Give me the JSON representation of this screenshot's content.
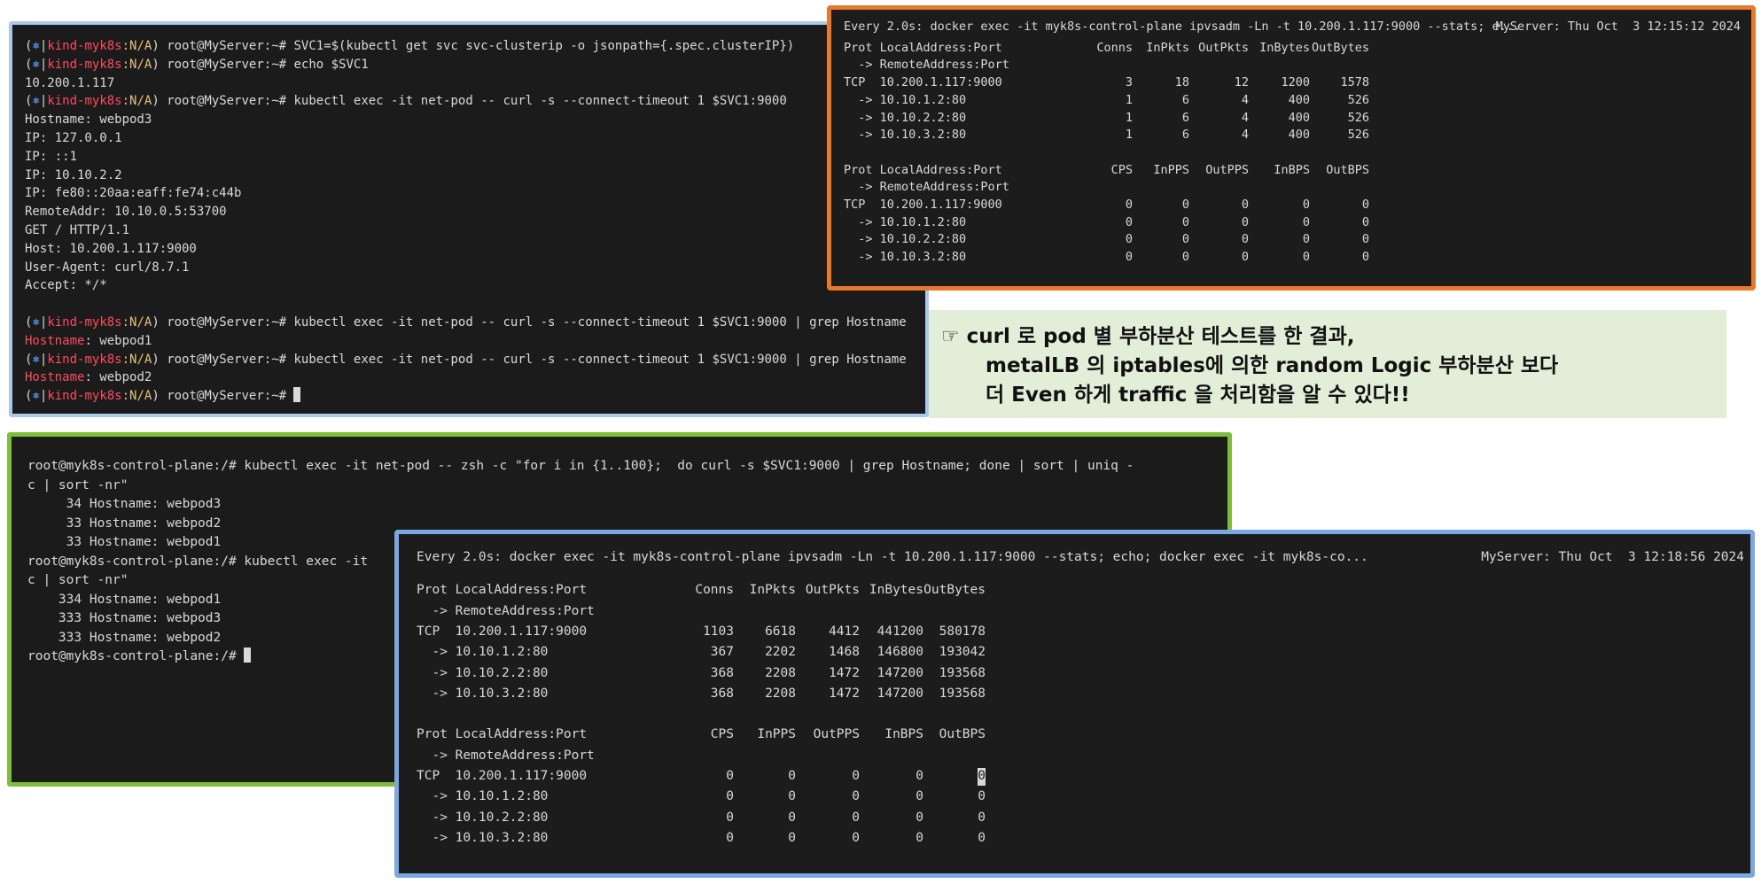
{
  "colors": {
    "panel1_border": "#a9c8ec",
    "panel2_border": "#e8782a",
    "panel3_border": "#7dbd3a",
    "panel4_border": "#79a9e0",
    "note_bg": "#e2eed8",
    "terminal_bg": "#1b1b1b",
    "prompt_blue": "#5aa0ff",
    "prompt_red": "#ff4b5c"
  },
  "terminal1": {
    "prompt": {
      "open": "(",
      "symbol": "⎈",
      "bar": "|",
      "context": "kind-myk8s",
      "ns": ":N/A",
      "close": ")",
      "user": " root@MyServer:~# "
    },
    "commands": [
      "SVC1=$(kubectl get svc svc-clusterip -o jsonpath={.spec.clusterIP})",
      "echo $SVC1",
      "kubectl exec -it net-pod -- curl -s --connect-timeout 1 $SVC1:9000",
      "kubectl exec -it net-pod -- curl -s --connect-timeout 1 $SVC1:9000 | grep Hostname",
      "kubectl exec -it net-pod -- curl -s --connect-timeout 1 $SVC1:9000 | grep Hostname"
    ],
    "echo_output": "10.200.1.117",
    "curl_output": [
      "Hostname: webpod3",
      "IP: 127.0.0.1",
      "IP: ::1",
      "IP: 10.10.2.2",
      "IP: fe80::20aa:eaff:fe74:c44b",
      "RemoteAddr: 10.10.0.5:53700",
      "GET / HTTP/1.1",
      "Host: 10.200.1.117:9000",
      "User-Agent: curl/8.7.1",
      "Accept: */*"
    ],
    "grep_key": "Hostname",
    "grep_results": [
      ": webpod1",
      ": webpod2"
    ]
  },
  "watch1": {
    "header_left": "Every 2.0s: docker exec -it myk8s-control-plane ipvsadm -Ln -t 10.200.1.117:9000 --stats; e...",
    "header_right": "MyServer: Thu Oct  3 12:15:12 2024",
    "stats_headers": [
      "Prot LocalAddress:Port",
      "Conns",
      "InPkts",
      "OutPkts",
      "InBytes",
      "OutBytes"
    ],
    "remote_header": "  -> RemoteAddress:Port",
    "stats_rows": [
      [
        "TCP  10.200.1.117:9000",
        "3",
        "18",
        "12",
        "1200",
        "1578"
      ],
      [
        "  -> 10.10.1.2:80",
        "1",
        "6",
        "4",
        "400",
        "526"
      ],
      [
        "  -> 10.10.2.2:80",
        "1",
        "6",
        "4",
        "400",
        "526"
      ],
      [
        "  -> 10.10.3.2:80",
        "1",
        "6",
        "4",
        "400",
        "526"
      ]
    ],
    "rate_headers": [
      "Prot LocalAddress:Port",
      "CPS",
      "InPPS",
      "OutPPS",
      "InBPS",
      "OutBPS"
    ],
    "rate_rows": [
      [
        "TCP  10.200.1.117:9000",
        "0",
        "0",
        "0",
        "0",
        "0"
      ],
      [
        "  -> 10.10.1.2:80",
        "0",
        "0",
        "0",
        "0",
        "0"
      ],
      [
        "  -> 10.10.2.2:80",
        "0",
        "0",
        "0",
        "0",
        "0"
      ],
      [
        "  -> 10.10.3.2:80",
        "0",
        "0",
        "0",
        "0",
        "0"
      ]
    ]
  },
  "note": {
    "icon": "☞",
    "line1": "curl 로 pod 별 부하분산 테스트를 한 결과,",
    "line2": "metalLB 의 iptables에 의한 random Logic 부하분산 보다",
    "line3": "더 Even 하게 traffic 을 처리함을 알 수 있다!!"
  },
  "terminal3": {
    "lines": [
      "root@myk8s-control-plane:/# kubectl exec -it net-pod -- zsh -c \"for i in {1..100};  do curl -s $SVC1:9000 | grep Hostname; done | sort | uniq -",
      "c | sort -nr\"",
      "     34 Hostname: webpod3",
      "     33 Hostname: webpod2",
      "     33 Hostname: webpod1",
      "root@myk8s-control-plane:/# kubectl exec -it",
      "c | sort -nr\"",
      "    334 Hostname: webpod1",
      "    333 Hostname: webpod3",
      "    333 Hostname: webpod2",
      "root@myk8s-control-plane:/# "
    ]
  },
  "watch2": {
    "header_left": "Every 2.0s: docker exec -it myk8s-control-plane ipvsadm -Ln -t 10.200.1.117:9000 --stats; echo; docker exec -it myk8s-co...",
    "header_right": "MyServer: Thu Oct  3 12:18:56 2024",
    "stats_headers": [
      "Prot LocalAddress:Port",
      "Conns",
      "InPkts",
      "OutPkts",
      "InBytes",
      "OutBytes"
    ],
    "remote_header": "  -> RemoteAddress:Port",
    "stats_rows": [
      [
        "TCP  10.200.1.117:9000",
        "1103",
        "6618",
        "4412",
        "441200",
        "580178"
      ],
      [
        "  -> 10.10.1.2:80",
        "367",
        "2202",
        "1468",
        "146800",
        "193042"
      ],
      [
        "  -> 10.10.2.2:80",
        "368",
        "2208",
        "1472",
        "147200",
        "193568"
      ],
      [
        "  -> 10.10.3.2:80",
        "368",
        "2208",
        "1472",
        "147200",
        "193568"
      ]
    ],
    "rate_headers": [
      "Prot LocalAddress:Port",
      "CPS",
      "InPPS",
      "OutPPS",
      "InBPS",
      "OutBPS"
    ],
    "rate_rows": [
      [
        "TCP  10.200.1.117:9000",
        "0",
        "0",
        "0",
        "0",
        "0"
      ],
      [
        "  -> 10.10.1.2:80",
        "0",
        "0",
        "0",
        "0",
        "0"
      ],
      [
        "  -> 10.10.2.2:80",
        "0",
        "0",
        "0",
        "0",
        "0"
      ],
      [
        "  -> 10.10.3.2:80",
        "0",
        "0",
        "0",
        "0",
        "0"
      ]
    ]
  }
}
